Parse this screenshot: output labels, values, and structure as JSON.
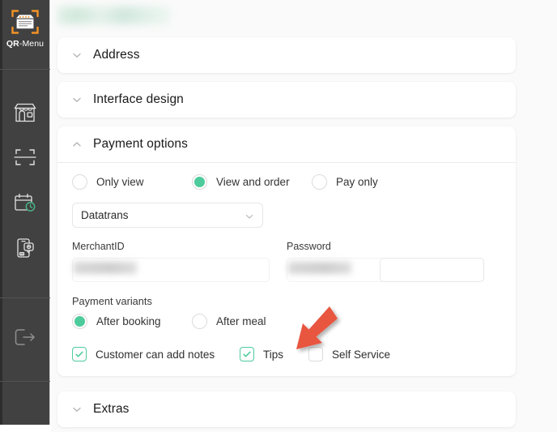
{
  "sidebar": {
    "logo": {
      "icon": "qr-menu-logo-icon",
      "label_strong": "QR",
      "label_rest": "-Menu",
      "bracket_color": "#F39325",
      "background": "#414141"
    },
    "items": [
      {
        "icon": "storefront-icon",
        "label": "Restaurant"
      },
      {
        "icon": "qr-scanner-icon",
        "label": "QR codes"
      },
      {
        "icon": "calendar-clock-icon",
        "label": "Reservations"
      },
      {
        "icon": "mobile-notification-icon",
        "label": "App settings"
      }
    ],
    "footer": [
      {
        "icon": "logout-icon",
        "label": "Logout"
      }
    ]
  },
  "main": {
    "page_title_redacted": "",
    "accent_green": "#4ECB9C",
    "annotation_arrow_color": "#E8573F",
    "cards": [
      {
        "title": "Address",
        "expanded": false,
        "chevron": "chevron-down-icon"
      },
      {
        "title": "Interface design",
        "expanded": false,
        "chevron": "chevron-down-icon"
      },
      {
        "title": "Payment options",
        "expanded": true,
        "chevron": "chevron-up-icon"
      },
      {
        "title": "Extras",
        "expanded": false,
        "chevron": "chevron-down-icon"
      }
    ],
    "payment_options": {
      "view_mode": {
        "selected": "View and order",
        "options": [
          {
            "label": "Only view",
            "checked": false
          },
          {
            "label": "View and order",
            "checked": true
          },
          {
            "label": "Pay only",
            "checked": false
          }
        ]
      },
      "provider_select": {
        "value": "Datatrans",
        "chevron": "chevron-down-icon",
        "options": [
          "Datatrans"
        ]
      },
      "fields": [
        {
          "label": "MerchantID",
          "value": "",
          "redacted": true,
          "placeholder": ""
        },
        {
          "label": "Password",
          "value": "",
          "redacted": true,
          "placeholder": ""
        }
      ],
      "payment_variants": {
        "group_label": "Payment variants",
        "selected": "After booking",
        "options": [
          {
            "label": "After booking",
            "checked": true
          },
          {
            "label": "After meal",
            "checked": false
          }
        ]
      },
      "toggles": [
        {
          "label": "Customer can add notes",
          "checked": true
        },
        {
          "label": "Tips",
          "checked": true,
          "annotated": true
        },
        {
          "label": "Self Service",
          "checked": false
        }
      ]
    }
  }
}
